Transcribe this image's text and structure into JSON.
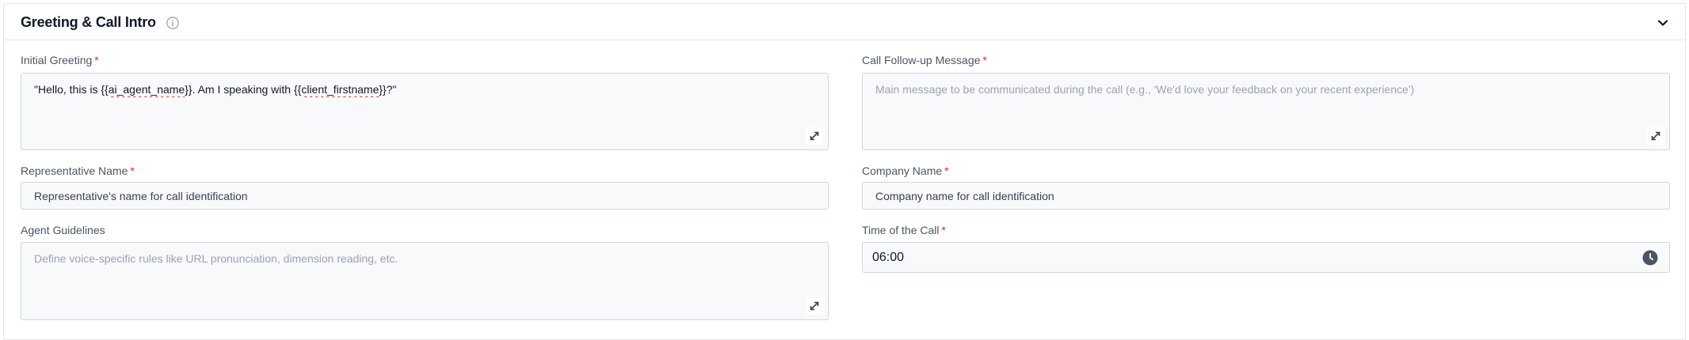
{
  "section": {
    "title": "Greeting & Call Intro",
    "info_icon": "info-circle-icon",
    "collapse_icon": "chevron-down-icon"
  },
  "fields": {
    "initial_greeting": {
      "label": "Initial Greeting",
      "required_mark": "*",
      "value_prefix": "\"Hello, this is {{",
      "value_var1": "ai_agent_name",
      "value_mid": "}}. Am I speaking with {{",
      "value_var2": "client_firstname",
      "value_suffix": "}}?\""
    },
    "call_followup": {
      "label": "Call Follow-up Message",
      "required_mark": "*",
      "placeholder": "Main message to be communicated during the call (e.g., 'We'd love your feedback on your recent experience')"
    },
    "representative_name": {
      "label": "Representative Name",
      "required_mark": "*",
      "placeholder": "Representative's name for call identification"
    },
    "company_name": {
      "label": "Company Name",
      "required_mark": "*",
      "placeholder": "Company name for call identification"
    },
    "agent_guidelines": {
      "label": "Agent Guidelines",
      "placeholder": "Define voice-specific rules like URL pronunciation, dimension reading, etc."
    },
    "time_of_call": {
      "label": "Time of the Call",
      "required_mark": "*",
      "value": "06:00",
      "icon": "clock-icon"
    }
  },
  "colors": {
    "required": "#dc2626",
    "field_bg": "#f8f9fb",
    "border": "#d1d5db"
  }
}
